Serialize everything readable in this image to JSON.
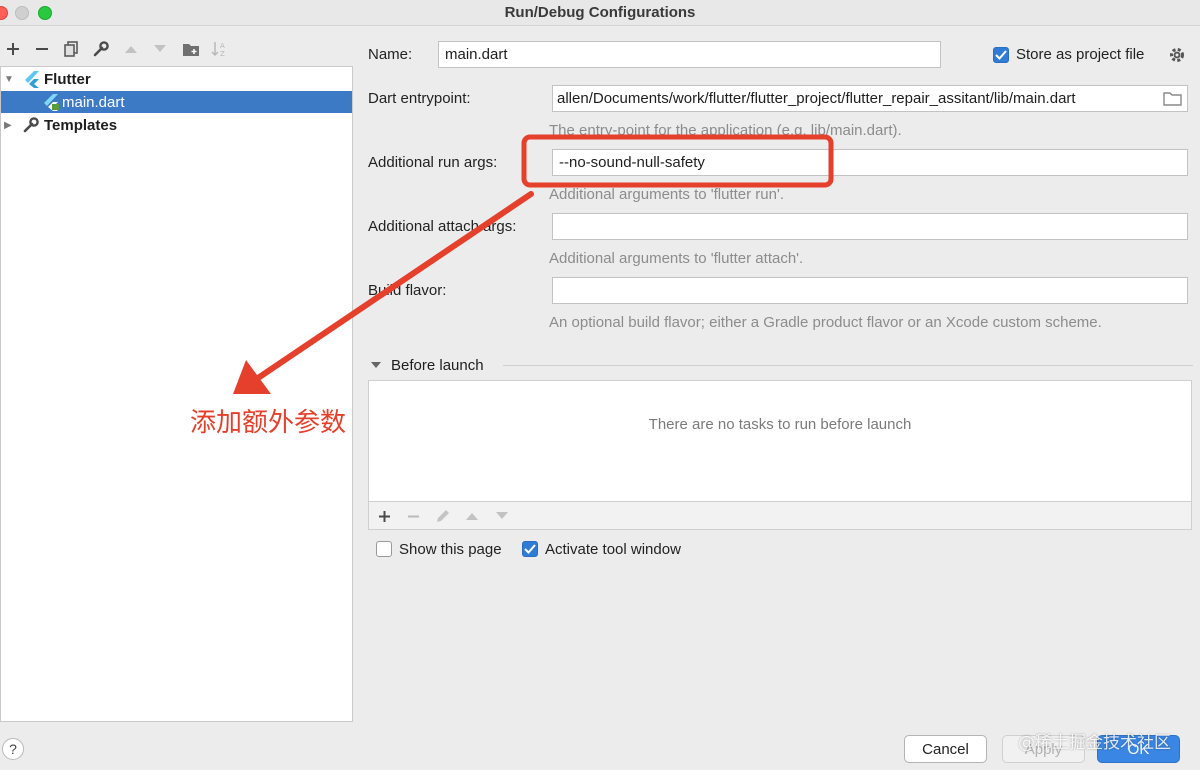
{
  "window": {
    "title": "Run/Debug Configurations"
  },
  "toolbar": {
    "icons": [
      "add-icon",
      "remove-icon",
      "copy-icon",
      "wrench-icon",
      "move-up-icon",
      "move-down-icon",
      "folder-icon",
      "sort-icon"
    ]
  },
  "tree": {
    "items": [
      {
        "label": "Flutter",
        "icon": "flutter-icon",
        "expanded": true
      },
      {
        "label": "main.dart",
        "icon": "flutter-dart-file-icon",
        "selected": true
      },
      {
        "label": "Templates",
        "icon": "wrench-icon",
        "expanded": false
      }
    ]
  },
  "form": {
    "name_label": "Name:",
    "name_value": "main.dart",
    "store_label": "Store as project file",
    "store_checked": true,
    "entrypoint_label": "Dart entrypoint:",
    "entrypoint_value": "allen/Documents/work/flutter/flutter_project/flutter_repair_assitant/lib/main.dart",
    "entrypoint_hint": "The entry-point for the application (e.g. lib/main.dart).",
    "run_args_label": "Additional run args:",
    "run_args_value": "--no-sound-null-safety",
    "run_args_hint": "Additional arguments to 'flutter run'.",
    "attach_args_label": "Additional attach args:",
    "attach_args_value": "",
    "attach_args_hint": "Additional arguments to 'flutter attach'.",
    "build_flavor_label": "Build flavor:",
    "build_flavor_value": "",
    "build_flavor_hint": "An optional build flavor; either a Gradle product flavor or an Xcode custom scheme."
  },
  "before_launch": {
    "title": "Before launch",
    "empty_text": "There are no tasks to run before launch",
    "icons": [
      "add-icon",
      "remove-icon",
      "edit-icon",
      "move-up-icon",
      "move-down-icon"
    ]
  },
  "options": {
    "show_page_label": "Show this page",
    "show_page_checked": false,
    "activate_label": "Activate tool window",
    "activate_checked": true
  },
  "buttons": {
    "help": "?",
    "cancel": "Cancel",
    "apply": "Apply",
    "ok": "OK"
  },
  "annotation": {
    "text": "添加额外参数",
    "color": "#e4402c"
  },
  "watermark": "@稀土掘金技术社区",
  "colors": {
    "selection": "#3d7ac5",
    "accent": "#2f7bd6",
    "annotation_red": "#e4402c"
  }
}
